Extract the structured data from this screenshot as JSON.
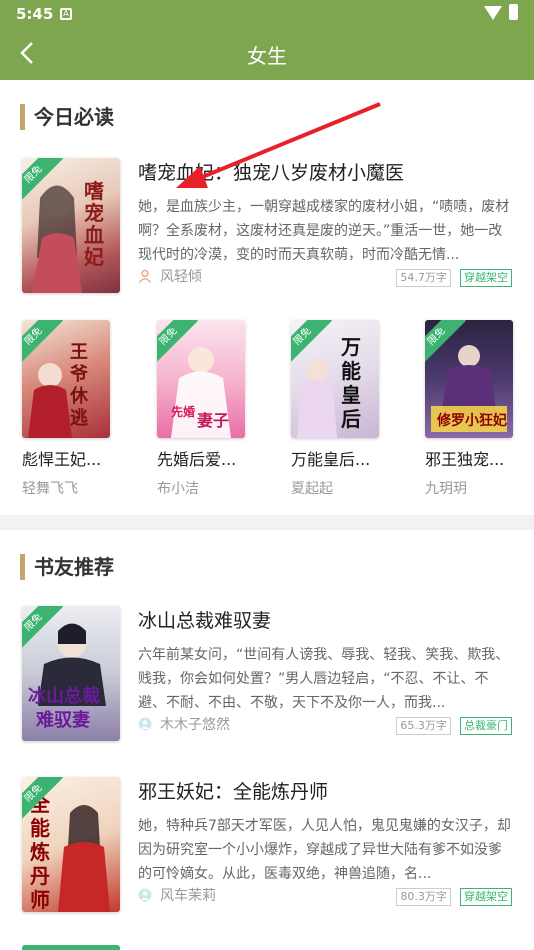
{
  "status": {
    "time": "5:45",
    "notification_icon": "a-icon",
    "wifi_icon": "wifi-icon",
    "battery_icon": "battery-icon"
  },
  "header": {
    "title": "女生",
    "back_icon": "back-icon",
    "bg": "#7ea64f"
  },
  "badge_label": "限免",
  "today": {
    "title": "今日必读",
    "featured": {
      "title": "嗜宠血妃：独宠八岁废材小魔医",
      "desc": "她，是血族少主，一朝穿越成楼家的废材小姐，“啧啧，废材啊？全系废材，这废材还真是废的逆天。”重活一世，她一改现代时的冷漠，变的时而天真软萌，时而冷酷无情...",
      "author": "风轻倾",
      "words": "54.7万字",
      "category": "穿越架空"
    },
    "grid": [
      {
        "title": "彪悍王妃...",
        "author": "轻舞飞飞"
      },
      {
        "title": "先婚后爱...",
        "author": "布小洁"
      },
      {
        "title": "万能皇后...",
        "author": "夏起起"
      },
      {
        "title": "邪王独宠...",
        "author": "九玥玥"
      }
    ]
  },
  "recommend": {
    "title": "书友推荐",
    "books": [
      {
        "title": "冰山总裁难驭妻",
        "desc": "六年前某女问，“世间有人谤我、辱我、轻我、笑我、欺我、贱我，你会如何处置？”男人唇边轻启，“不忍、不让、不避、不耐、不由、不敬，天下不及你一人，而我...",
        "author": "木木子悠然",
        "words": "65.3万字",
        "category": "总裁豪门"
      },
      {
        "title": "邪王妖妃：全能炼丹师",
        "desc": "她，特种兵7部天才军医，人见人怕，鬼见鬼嫌的女汉子，却因为研究室一个小小爆炸，穿越成了异世大陆有爹不如没爹的可怜嫡女。从此，医毒双绝，神兽追随，名...",
        "author": "风车茉莉",
        "words": "80.3万字",
        "category": "穿越架空"
      }
    ]
  },
  "colors": {
    "accent": "#7ea64f",
    "tag_green": "#3cb371",
    "section_bar": "#c6a56a",
    "arrow": "#e8202a"
  }
}
